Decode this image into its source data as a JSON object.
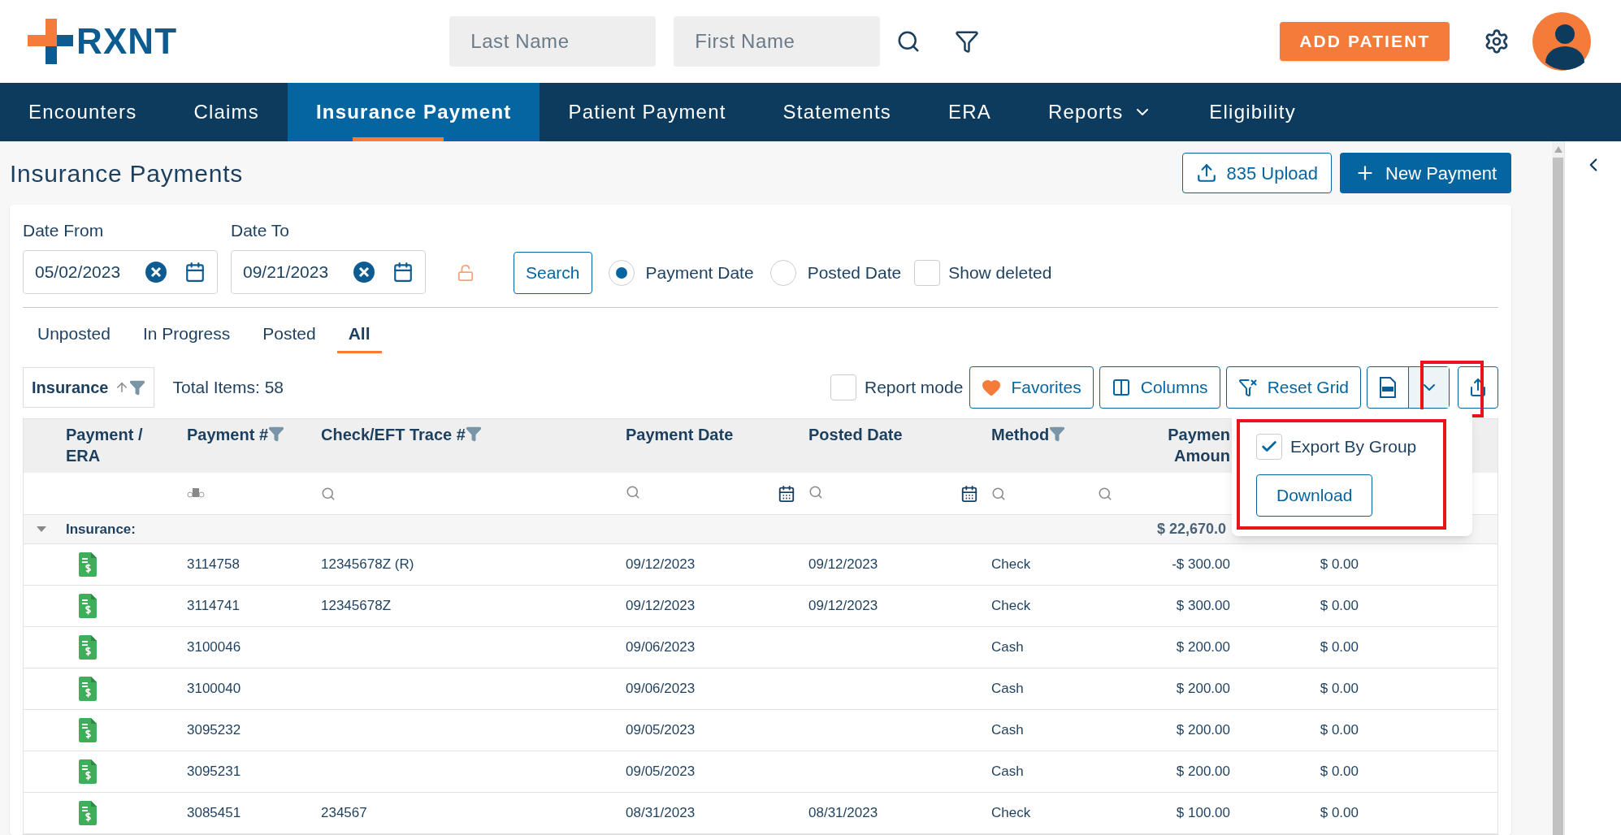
{
  "brand": "RXNT",
  "header": {
    "last_name": {
      "placeholder": "Last Name"
    },
    "first_name": {
      "placeholder": "First Name"
    },
    "add_patient": "ADD PATIENT"
  },
  "nav": [
    {
      "label": "Encounters",
      "selected": false
    },
    {
      "label": "Claims",
      "selected": false
    },
    {
      "label": "Insurance Payment",
      "selected": true
    },
    {
      "label": "Patient Payment",
      "selected": false
    },
    {
      "label": "Statements",
      "selected": false
    },
    {
      "label": "ERA",
      "selected": false
    },
    {
      "label": "Reports",
      "selected": false,
      "dropdown": true
    },
    {
      "label": "Eligibility",
      "selected": false
    }
  ],
  "page_title": "Insurance Payments",
  "actions": {
    "upload": "835 Upload",
    "new_payment": "New Payment"
  },
  "filters": {
    "date_from": {
      "label": "Date From",
      "value": "05/02/2023"
    },
    "date_to": {
      "label": "Date To",
      "value": "09/21/2023"
    },
    "search": "Search",
    "date_type": [
      {
        "label": "Payment Date",
        "selected": true
      },
      {
        "label": "Posted Date",
        "selected": false
      }
    ],
    "show_deleted": {
      "label": "Show deleted",
      "checked": false
    }
  },
  "status_tabs": [
    {
      "label": "Unposted",
      "selected": false
    },
    {
      "label": "In Progress",
      "selected": false
    },
    {
      "label": "Posted",
      "selected": false
    },
    {
      "label": "All",
      "selected": true
    }
  ],
  "group_chip": "Insurance",
  "total_items": "Total Items: 58",
  "toolbar": {
    "report_mode": {
      "label": "Report mode",
      "checked": false
    },
    "favorites": "Favorites",
    "columns": "Columns",
    "reset_grid": "Reset Grid"
  },
  "export_menu": {
    "export_by_group": {
      "label": "Export By Group",
      "checked": true
    },
    "download": "Download"
  },
  "table": {
    "columns": [
      {
        "lines": [
          "Payment /",
          "ERA"
        ],
        "filter": false
      },
      {
        "lines": [
          "Payment #"
        ],
        "filter": true
      },
      {
        "lines": [
          "Check/EFT Trace #"
        ],
        "filter": true
      },
      {
        "lines": [
          "Payment Date"
        ],
        "filter": false
      },
      {
        "lines": [
          "Posted Date"
        ],
        "filter": false
      },
      {
        "lines": [
          "Method"
        ],
        "filter": true
      },
      {
        "lines": [
          "Paymen",
          "Amoun"
        ],
        "filter": false
      }
    ],
    "group": {
      "label": "Insurance:",
      "total": "$ 22,670.0"
    },
    "rows": [
      {
        "payment_no": "3114758",
        "trace": "12345678Z (R)",
        "payment_date": "09/12/2023",
        "posted_date": "09/12/2023",
        "method": "Check",
        "amount": "-$ 300.00",
        "column_8": "$ 0.00"
      },
      {
        "payment_no": "3114741",
        "trace": "12345678Z",
        "payment_date": "09/12/2023",
        "posted_date": "09/12/2023",
        "method": "Check",
        "amount": "$ 300.00",
        "column_8": "$ 0.00"
      },
      {
        "payment_no": "3100046",
        "trace": "",
        "payment_date": "09/06/2023",
        "posted_date": "",
        "method": "Cash",
        "amount": "$ 200.00",
        "column_8": "$ 0.00"
      },
      {
        "payment_no": "3100040",
        "trace": "",
        "payment_date": "09/06/2023",
        "posted_date": "",
        "method": "Cash",
        "amount": "$ 200.00",
        "column_8": "$ 0.00"
      },
      {
        "payment_no": "3095232",
        "trace": "",
        "payment_date": "09/05/2023",
        "posted_date": "",
        "method": "Cash",
        "amount": "$ 200.00",
        "column_8": "$ 0.00"
      },
      {
        "payment_no": "3095231",
        "trace": "",
        "payment_date": "09/05/2023",
        "posted_date": "",
        "method": "Cash",
        "amount": "$ 200.00",
        "column_8": "$ 0.00"
      },
      {
        "payment_no": "3085451",
        "trace": "234567",
        "payment_date": "08/31/2023",
        "posted_date": "08/31/2023",
        "method": "Check",
        "amount": "$ 100.00",
        "column_8": "$ 0.00"
      }
    ]
  }
}
